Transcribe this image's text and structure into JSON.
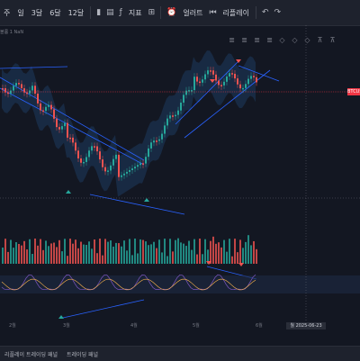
{
  "toolbar": {
    "items": [
      "주",
      "일",
      "3달",
      "6달",
      "12달"
    ],
    "indicators_label": "지표",
    "alert_label": "얼러트",
    "replay_label": "리플레이"
  },
  "legend": {
    "text": "볼륨 1 NaN"
  },
  "price_tag": "BTCUSD",
  "xaxis": {
    "labels": [
      "2월",
      "3월",
      "4월",
      "5월",
      "6월"
    ],
    "crosshair_date": "월 2025-06-23"
  },
  "bottom_tabs": [
    "리플레이 트레이딩 패널",
    "트레이딩 패널"
  ],
  "icons": [
    "undo-icon",
    "redo-icon",
    "indicators-icon",
    "alert-icon",
    "replay-icon",
    "layout-icon"
  ],
  "colors": {
    "up": "#26a69a",
    "down": "#ef5350",
    "trendline": "#2962ff",
    "bands": "#1e3a5f"
  }
}
